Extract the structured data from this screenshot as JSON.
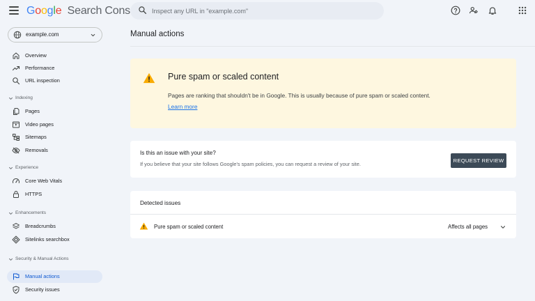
{
  "header": {
    "logo_letters": [
      {
        "ch": "G",
        "color": "#4285f4"
      },
      {
        "ch": "o",
        "color": "#ea4335"
      },
      {
        "ch": "o",
        "color": "#fbbc05"
      },
      {
        "ch": "g",
        "color": "#4285f4"
      },
      {
        "ch": "l",
        "color": "#34a853"
      },
      {
        "ch": "e",
        "color": "#ea4335"
      }
    ],
    "product_name": "Search Console",
    "search_placeholder": "Inspect any URL in \"example.com\"",
    "icons": [
      "menu-icon",
      "search-icon",
      "help-icon",
      "manage-users-icon",
      "notifications-icon",
      "apps-icon"
    ]
  },
  "sidebar": {
    "property": "example.com",
    "top_items": [
      {
        "label": "Overview",
        "icon": "home-icon"
      },
      {
        "label": "Performance",
        "icon": "trending-up-icon"
      },
      {
        "label": "URL inspection",
        "icon": "search-icon"
      }
    ],
    "sections": [
      {
        "title": "Indexing",
        "items": [
          {
            "label": "Pages",
            "icon": "pages-icon"
          },
          {
            "label": "Video pages",
            "icon": "video-pages-icon"
          },
          {
            "label": "Sitemaps",
            "icon": "sitemaps-icon"
          },
          {
            "label": "Removals",
            "icon": "removals-icon"
          }
        ]
      },
      {
        "title": "Experience",
        "items": [
          {
            "label": "Core Web Vitals",
            "icon": "speed-icon"
          },
          {
            "label": "HTTPS",
            "icon": "lock-icon"
          }
        ]
      },
      {
        "title": "Enhancements",
        "items": [
          {
            "label": "Breadcrumbs",
            "icon": "layers-icon"
          },
          {
            "label": "Sitelinks searchbox",
            "icon": "diamond-icon"
          }
        ]
      },
      {
        "title": "Security & Manual Actions",
        "items": [
          {
            "label": "Manual actions",
            "icon": "flag-icon",
            "active": true
          },
          {
            "label": "Security issues",
            "icon": "shield-icon"
          }
        ]
      }
    ]
  },
  "main": {
    "page_title": "Manual actions",
    "alert": {
      "title": "Pure spam or scaled content",
      "description": "Pages are ranking that shouldn't be in Google. This is usually because of pure spam or scaled content.",
      "link": "Learn more",
      "icon": "warning-icon"
    },
    "review": {
      "question": "Is this an issue with your site?",
      "description": "If you believe that your site follows Google's spam policies, you can request a review of your site.",
      "button": "REQUEST REVIEW"
    },
    "issues": {
      "heading": "Detected issues",
      "rows": [
        {
          "name": "Pure spam or scaled content",
          "affects": "Affects all pages",
          "icon": "warning-icon"
        }
      ]
    }
  },
  "colors": {
    "background": "#f1f4f9",
    "alert_background": "#fef7e0",
    "warning": "#f9ab00",
    "link": "#1a73e8",
    "active_nav": "#e1e9f7",
    "button": "#3c4a57"
  }
}
